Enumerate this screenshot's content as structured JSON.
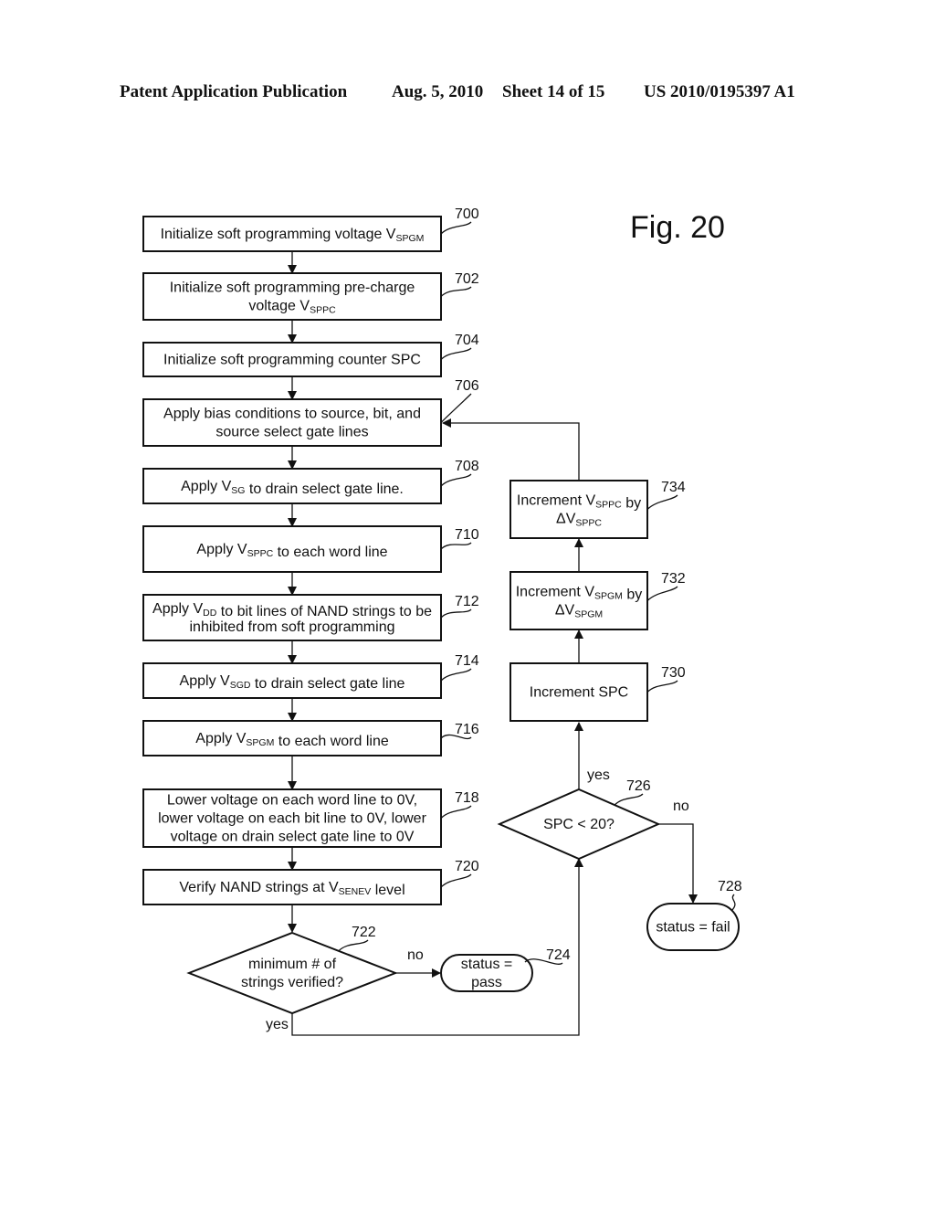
{
  "header": {
    "publication": "Patent Application Publication",
    "date": "Aug. 5, 2010",
    "sheet": "Sheet 14 of 15",
    "number": "US 2010/0195397 A1"
  },
  "figure": {
    "title": "Fig. 20"
  },
  "steps": {
    "s700": {
      "ref": "700",
      "lines": [
        [
          {
            "t": "Initialize soft programming voltage V"
          },
          {
            "t": "SPGM",
            "sub": true
          }
        ]
      ]
    },
    "s702": {
      "ref": "702",
      "lines": [
        [
          {
            "t": "Initialize soft programming pre-charge"
          }
        ],
        [
          {
            "t": "voltage V"
          },
          {
            "t": "SPPC",
            "sub": true
          }
        ]
      ]
    },
    "s704": {
      "ref": "704",
      "lines": [
        [
          {
            "t": "Initialize soft programming counter SPC"
          }
        ]
      ]
    },
    "s706": {
      "ref": "706",
      "lines": [
        [
          {
            "t": "Apply bias conditions to source, bit, and"
          }
        ],
        [
          {
            "t": "source select gate lines"
          }
        ]
      ]
    },
    "s708": {
      "ref": "708",
      "lines": [
        [
          {
            "t": "Apply V"
          },
          {
            "t": "SG",
            "sub": true
          },
          {
            "t": " to drain select gate line."
          }
        ]
      ]
    },
    "s710": {
      "ref": "710",
      "lines": [
        [
          {
            "t": "Apply V"
          },
          {
            "t": "SPPC",
            "sub": true
          },
          {
            "t": " to each word line"
          }
        ]
      ]
    },
    "s712": {
      "ref": "712",
      "lines": [
        [
          {
            "t": "Apply V"
          },
          {
            "t": "DD",
            "sub": true
          },
          {
            "t": " to bit lines of NAND strings to be"
          }
        ],
        [
          {
            "t": "inhibited from soft programming"
          }
        ]
      ]
    },
    "s714": {
      "ref": "714",
      "lines": [
        [
          {
            "t": "Apply V"
          },
          {
            "t": "SGD",
            "sub": true
          },
          {
            "t": " to drain select gate line"
          }
        ]
      ]
    },
    "s716": {
      "ref": "716",
      "lines": [
        [
          {
            "t": "Apply V"
          },
          {
            "t": "SPGM",
            "sub": true
          },
          {
            "t": " to each word line"
          }
        ]
      ]
    },
    "s718": {
      "ref": "718",
      "lines": [
        [
          {
            "t": "Lower voltage on each word line to 0V,"
          }
        ],
        [
          {
            "t": "lower voltage on each bit line to 0V, lower"
          }
        ],
        [
          {
            "t": "voltage on drain select gate line to 0V"
          }
        ]
      ]
    },
    "s720": {
      "ref": "720",
      "lines": [
        [
          {
            "t": "Verify NAND strings at V"
          },
          {
            "t": "SENEV",
            "sub": true
          },
          {
            "t": " level"
          }
        ]
      ]
    },
    "s722": {
      "ref": "722",
      "lines": [
        [
          {
            "t": "minimum # of"
          }
        ],
        [
          {
            "t": "strings verified?"
          }
        ]
      ]
    },
    "s724": {
      "ref": "724",
      "lines": [
        [
          {
            "t": "status ="
          }
        ],
        [
          {
            "t": "pass"
          }
        ]
      ]
    },
    "s726": {
      "ref": "726",
      "lines": [
        [
          {
            "t": "SPC < 20?"
          }
        ]
      ]
    },
    "s728": {
      "ref": "728",
      "lines": [
        [
          {
            "t": "status = fail"
          }
        ]
      ]
    },
    "s730": {
      "ref": "730",
      "lines": [
        [
          {
            "t": "Increment SPC"
          }
        ]
      ]
    },
    "s732": {
      "ref": "732",
      "lines": [
        [
          {
            "t": "Increment V"
          },
          {
            "t": "SPGM",
            "sub": true
          },
          {
            "t": " by"
          }
        ],
        [
          {
            "t": "ΔV"
          },
          {
            "t": "SPGM",
            "sub": true
          }
        ]
      ]
    },
    "s734": {
      "ref": "734",
      "lines": [
        [
          {
            "t": "Increment V"
          },
          {
            "t": "SPPC",
            "sub": true
          },
          {
            "t": " by"
          }
        ],
        [
          {
            "t": "ΔV"
          },
          {
            "t": "SPPC",
            "sub": true
          }
        ]
      ]
    }
  },
  "edge_labels": {
    "d722_no": "no",
    "d722_yes": "yes",
    "d726_yes": "yes",
    "d726_no": "no"
  }
}
